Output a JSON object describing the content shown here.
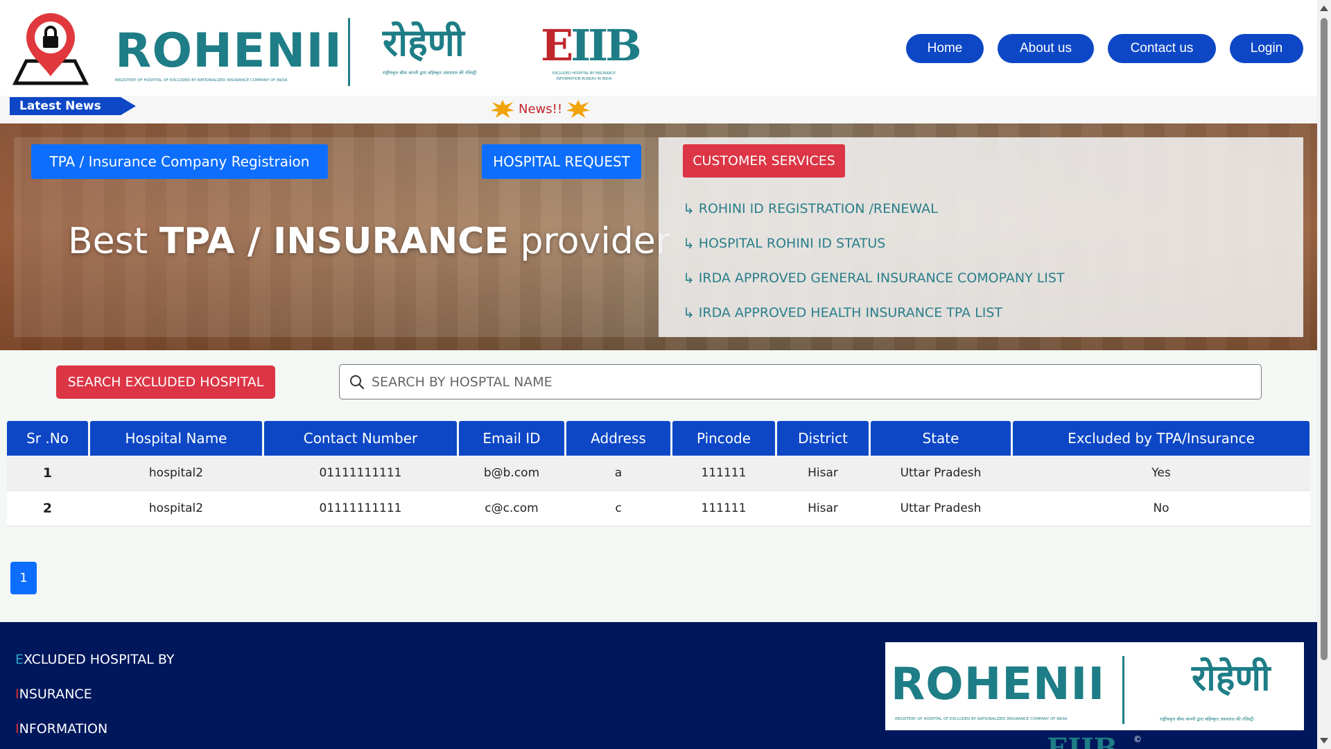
{
  "header": {
    "brand_en": "ROHENII",
    "brand_en_tagline": "REGISTERY OF HOSPITAL OF EXCLUDED BY NATIONALIZED INSURANCE COMPANY OF INDIA",
    "brand_hi": "रोहेणी",
    "brand_hi_tagline": "राष्ट्रीयकृत बीमा कंपनी द्वारा बहिष्कृत अस्पताल की रजिस्ट्री",
    "brand_eiib_e": "E",
    "brand_eiib_rest": "IIB",
    "brand_eiib_tagline": "EXCLUDED HOSPITAL BY INSURANCE INFORMATION BUREAU IN INDIA",
    "nav": {
      "home": "Home",
      "about": "About us",
      "contact": "Contact us",
      "login": "Login"
    }
  },
  "ticker": {
    "label": "Latest News",
    "news": "News!!"
  },
  "hero": {
    "tpa_button": "TPA / Insurance Company Registraion",
    "hospital_request_button": "HOSPITAL REQUEST",
    "title_pre": "Best ",
    "title_bold": "TPA / INSURANCE",
    "title_post": " provider",
    "customer_services_button": "CUSTOMER SERVICES",
    "services": [
      "ROHINI ID REGISTRATION /RENEWAL",
      "HOSPITAL ROHINI ID STATUS",
      "IRDA APPROVED GENERAL INSURANCE COMOPANY LIST",
      "IRDA APPROVED HEALTH INSURANCE TPA LIST"
    ]
  },
  "search": {
    "excluded_button": "SEARCH EXCLUDED HOSPITAL",
    "placeholder": "SEARCH BY HOSPTAL NAME"
  },
  "table": {
    "headers": [
      "Sr .No",
      "Hospital Name",
      "Contact Number",
      "Email ID",
      "Address",
      "Pincode",
      "District",
      "State",
      "Excluded by TPA/Insurance"
    ],
    "rows": [
      [
        "1",
        "hospital2",
        "01111111111",
        "b@b.com",
        "a",
        "111111",
        "Hisar",
        "Uttar Pradesh",
        "Yes"
      ],
      [
        "2",
        "hospital2",
        "01111111111",
        "c@c.com",
        "c",
        "111111",
        "Hisar",
        "Uttar Pradesh",
        "No"
      ]
    ]
  },
  "pagination": {
    "current": "1"
  },
  "footer": {
    "line1_initial": "E",
    "line1_rest": "XCLUDED HOSPITAL BY",
    "line2_initial": "I",
    "line2_rest": "NSURANCE",
    "line3_initial": "I",
    "line3_rest": "NFORMATION",
    "logo_en": "ROHENII",
    "logo_en_tagline": "REGISTERY OF HOSPITAL OF EXCLUDED BY NATIONALIZED INSURANCE COMPANY OF INDIA",
    "logo_hi": "रोहेणी",
    "logo_hi_tagline": "राष्ट्रीयकृत बीमा कंपनी द्वारा बहिष्कृत अस्पताल की रजिस्ट्री",
    "eiib": "EIIB",
    "copyright": "©"
  },
  "colors": {
    "nav_blue": "#0d47c6",
    "button_blue": "#0d6efd",
    "button_red": "#dc3545",
    "brand_teal": "#1e7d86",
    "footer_navy": "#00175c"
  }
}
